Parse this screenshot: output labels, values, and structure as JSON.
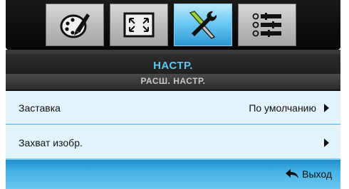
{
  "tabs": [
    {
      "icon": "palette-brush-icon",
      "label": ""
    },
    {
      "icon": "screen-expand-icon",
      "label": ""
    },
    {
      "icon": "tools-wrench-screwdriver-icon",
      "label": "",
      "active": true
    },
    {
      "icon": "options-list-icon",
      "label": ""
    }
  ],
  "header": {
    "title": "НАСТР.",
    "subtitle": "РАСШ. НАСТР."
  },
  "menu": {
    "items": [
      {
        "label": "Заставка",
        "value": "По умолчанию"
      },
      {
        "label": "Захват изобр.",
        "value": ""
      }
    ]
  },
  "footer": {
    "exit_label": "Выход",
    "exit_icon": "return-arrow-icon"
  },
  "colors": {
    "accent": "#5cc8f4",
    "active_tab": "#6cc9f3",
    "row_background": "#e3f3fc",
    "footer": "#46b2e6"
  }
}
